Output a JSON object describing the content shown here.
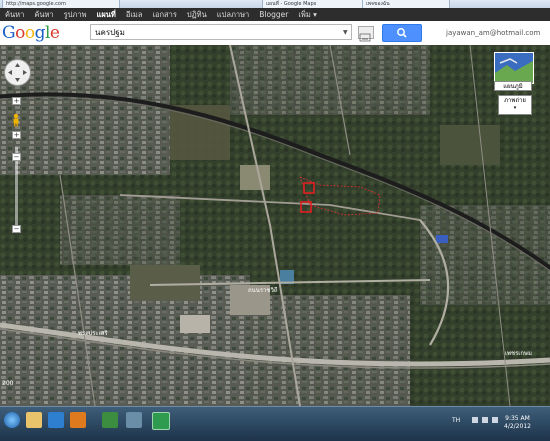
{
  "browser": {
    "tabs": [
      "http://maps.google.com",
      "แผนที่ - Google Maps",
      "เพจของฉัน"
    ]
  },
  "gbar": {
    "items": [
      {
        "label": "ค้นหา",
        "active": false
      },
      {
        "label": "ค้นหา",
        "active": false
      },
      {
        "label": "รูปภาพ",
        "active": false
      },
      {
        "label": "แผนที่",
        "active": true
      },
      {
        "label": "อีเมล",
        "active": false
      },
      {
        "label": "เอกสาร",
        "active": false
      },
      {
        "label": "ปฏิทิน",
        "active": false
      },
      {
        "label": "แปลภาษา",
        "active": false
      },
      {
        "label": "Blogger",
        "active": false
      },
      {
        "label": "เพิ่ม ▾",
        "active": false
      }
    ]
  },
  "search": {
    "logo_letters": [
      {
        "ch": "G",
        "color": "#1a5fc8"
      },
      {
        "ch": "o",
        "color": "#d93a2b"
      },
      {
        "ch": "o",
        "color": "#f2b50f"
      },
      {
        "ch": "g",
        "color": "#1a5fc8"
      },
      {
        "ch": "l",
        "color": "#2f9e44"
      },
      {
        "ch": "e",
        "color": "#d93a2b"
      }
    ],
    "query": "นครปฐม",
    "user_email": "jayawan_am@hotmail.com"
  },
  "map_controls": {
    "zoom_in": "+",
    "zoom_out": "−",
    "map_type_label": "แผนภูมิ",
    "satellite_label": "ภาพถ่าย",
    "satellite_arrow": "▾"
  },
  "map_labels": {
    "bottom_left_road": "พระประเสริ",
    "bottom_right_road": "เพชรเกษม",
    "middle_road": "ถนนราชวิถี",
    "left_edge_number": "200"
  },
  "taskbar": {
    "language": "TH",
    "time": "9:35 AM",
    "date": "4/2/2012"
  },
  "colors": {
    "gbar_bg": "#2d2d2d",
    "search_button": "#4d90fe",
    "marker": "#e02020"
  }
}
